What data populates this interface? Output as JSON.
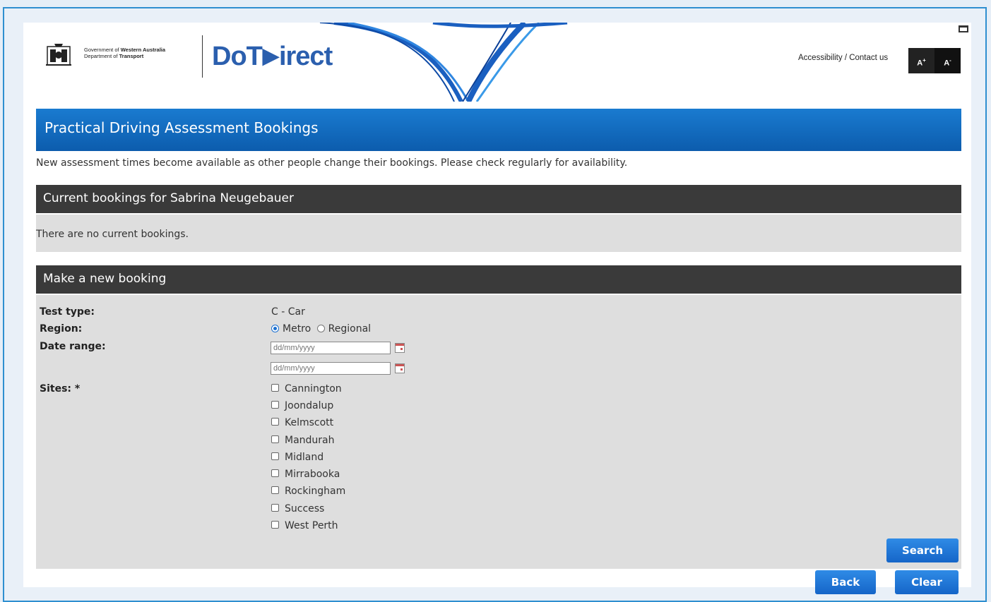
{
  "header": {
    "gov_line1_prefix": "Government of",
    "gov_line1_bold": "Western Australia",
    "gov_line2_prefix": "Department of",
    "gov_line2_bold": "Transport",
    "logo_do": "Do",
    "logo_t": "T",
    "logo_play": "▶",
    "logo_direct": "irect",
    "accessibility_link": "Accessibility / Contact us",
    "font_increase_label": "A",
    "font_increase_sup": "+",
    "font_decrease_label": "A",
    "font_decrease_sup": "-"
  },
  "page": {
    "title": "Practical Driving Assessment Bookings",
    "notice": "New assessment times become available as other people change their bookings. Please check regularly for availability."
  },
  "current": {
    "heading": "Current bookings for Sabrina Neugebauer",
    "message": "There are no current bookings."
  },
  "new_booking": {
    "heading": "Make a new booking",
    "test_type_label": "Test type:",
    "test_type_value": "C - Car",
    "region_label": "Region:",
    "region_options": [
      "Metro",
      "Regional"
    ],
    "region_selected": "Metro",
    "date_range_label": "Date range:",
    "date_from_placeholder": "dd/mm/yyyy",
    "date_to_placeholder": "dd/mm/yyyy",
    "sites_label": "Sites:  *",
    "sites": [
      "Cannington",
      "Joondalup",
      "Kelmscott",
      "Mandurah",
      "Midland",
      "Mirrabooka",
      "Rockingham",
      "Success",
      "West Perth"
    ]
  },
  "buttons": {
    "search": "Search",
    "back": "Back",
    "clear": "Clear"
  },
  "colors": {
    "title_bar": "#0f66b8",
    "section_header": "#3a3a3a",
    "button": "#1f74d8",
    "logo": "#2b5fae"
  }
}
